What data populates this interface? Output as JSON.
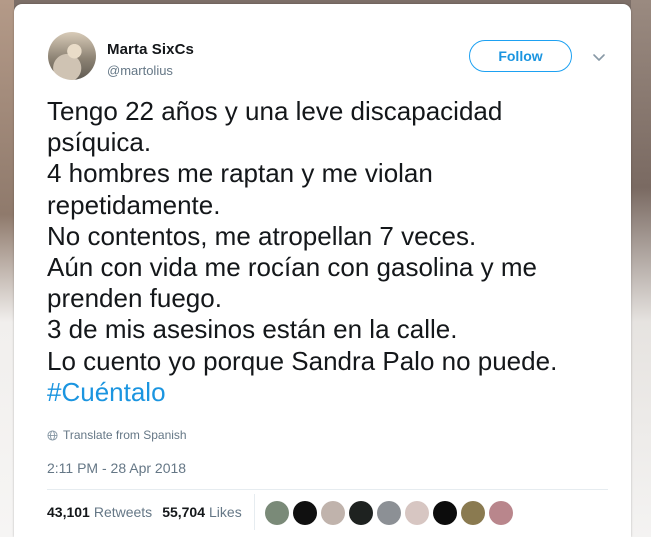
{
  "tweet": {
    "display_name": "Marta SixCs",
    "handle": "@martolius",
    "follow_label": "Follow",
    "text_lines": [
      "Tengo 22 años y una leve discapacidad",
      "psíquica.",
      "4 hombres me raptan y me violan",
      "repetidamente.",
      "No contentos, me atropellan 7 veces.",
      "Aún con vida me rocían con  gasolina y me",
      "prenden fuego.",
      "3 de mis asesinos están en la calle.",
      "Lo cuento yo porque Sandra Palo no puede."
    ],
    "hashtag": "#Cuéntalo",
    "translate_label": "Translate from Spanish",
    "timestamp": "2:11 PM - 28 Apr 2018"
  },
  "stats": {
    "retweets_count": "43,101",
    "retweets_label": "Retweets",
    "likes_count": "55,704",
    "likes_label": "Likes"
  },
  "liker_avatars": [
    {
      "color": "#7a8a78"
    },
    {
      "color": "#101010"
    },
    {
      "color": "#c0b3ac"
    },
    {
      "color": "#1e2220"
    },
    {
      "color": "#8c9095"
    },
    {
      "color": "#d7c6c2"
    },
    {
      "color": "#0c0c0c"
    },
    {
      "color": "#8a7a50"
    },
    {
      "color": "#b9868c"
    }
  ],
  "icons": {
    "chevron": "chevron-down-icon",
    "translate": "globe-icon"
  },
  "colors": {
    "accent": "#1b95e0",
    "text": "#14171a",
    "muted": "#657786"
  }
}
